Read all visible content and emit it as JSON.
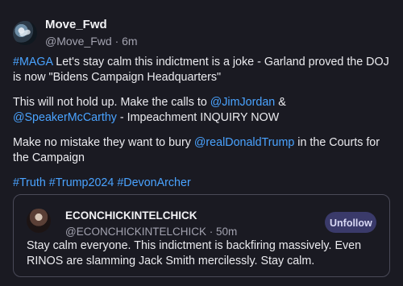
{
  "post": {
    "display_name": "Move_Fwd",
    "handle": "@Move_Fwd",
    "time": "6m",
    "paragraphs": [
      [
        {
          "text": "#MAGA",
          "link": true
        },
        {
          "text": " Let's stay calm this indictment is a joke - Garland proved the DOJ is now \"Bidens Campaign Headquarters\"",
          "link": false
        }
      ],
      [
        {
          "text": "This will not hold up.  Make the calls to ",
          "link": false
        },
        {
          "text": "@JimJordan",
          "link": true
        },
        {
          "text": " & ",
          "link": false
        },
        {
          "text": "@SpeakerMcCarthy",
          "link": true
        },
        {
          "text": " - Impeachment INQUIRY NOW",
          "link": false
        }
      ],
      [
        {
          "text": "Make no mistake they want to bury ",
          "link": false
        },
        {
          "text": "@realDonaldTrump",
          "link": true
        },
        {
          "text": " in the Courts for the Campaign",
          "link": false
        }
      ],
      [
        {
          "text": "#Truth",
          "link": true
        },
        {
          "text": " ",
          "link": false
        },
        {
          "text": "#Trump2024",
          "link": true
        },
        {
          "text": " ",
          "link": false
        },
        {
          "text": "#DevonArcher",
          "link": true
        }
      ]
    ]
  },
  "quote": {
    "display_name": "ECONCHICKINTELCHICK",
    "handle": "@ECONCHICKINTELCHICK",
    "time": "50m",
    "unfollow_label": "Unfollow",
    "text": "Stay calm everyone. This indictment is backfiring massively. Even RINOS are slamming Jack Smith mercilessly. Stay calm."
  },
  "colors": {
    "link": "#4aa3ff",
    "background": "#1a1a22",
    "button": "#3a3a6a"
  }
}
